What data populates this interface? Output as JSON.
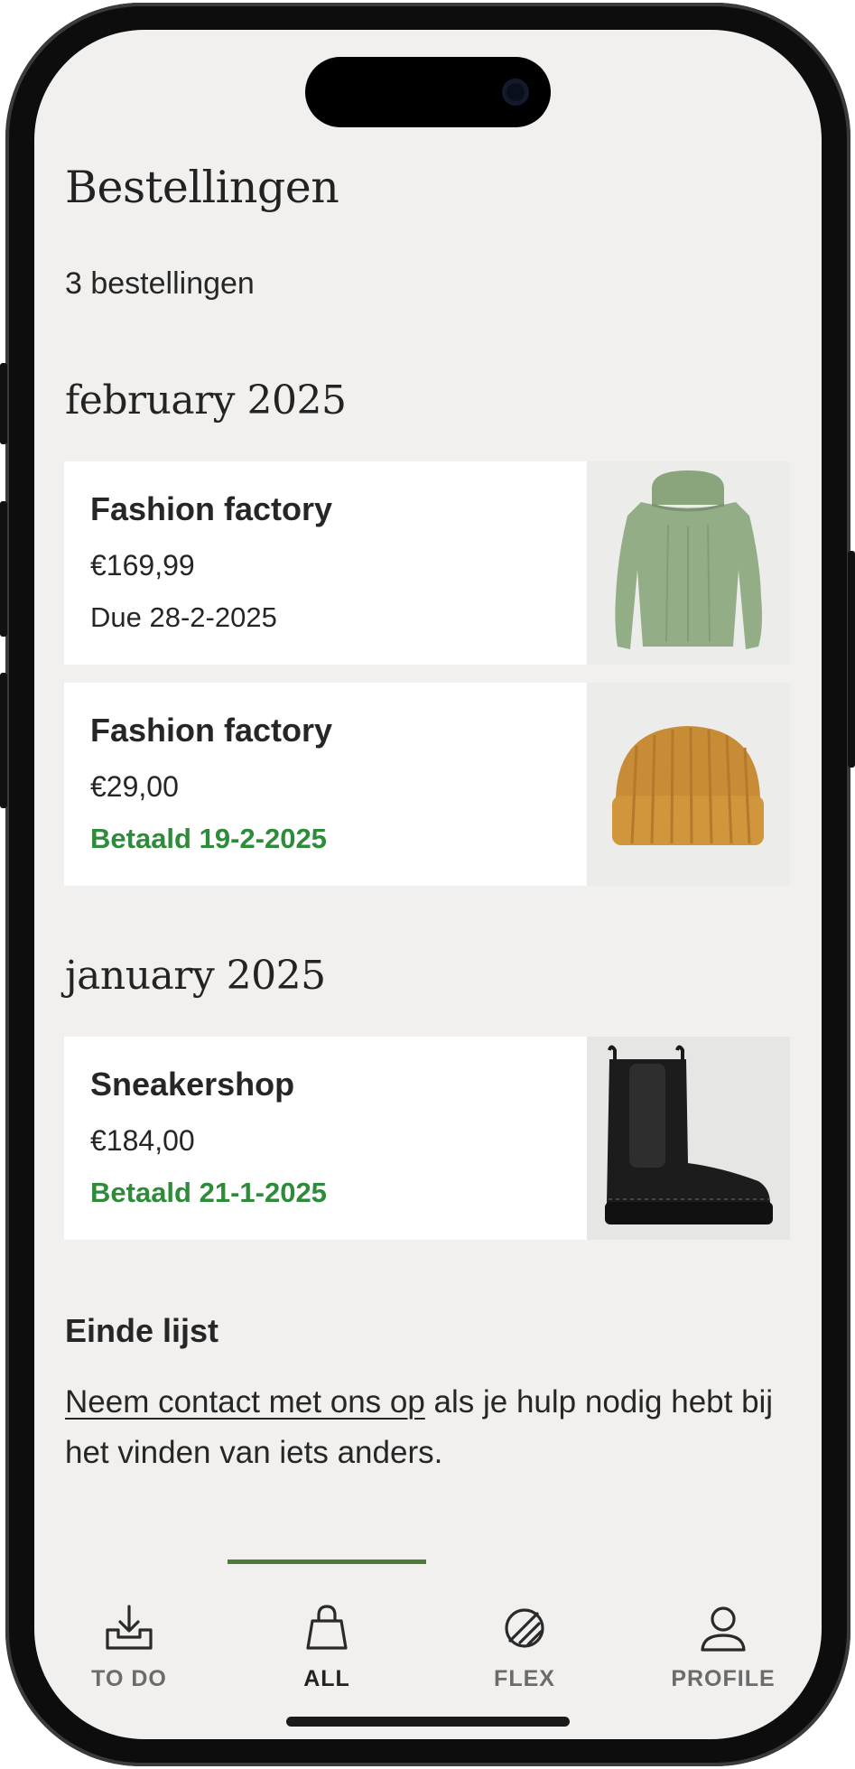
{
  "page": {
    "title": "Bestellingen",
    "count_text": "3 bestellingen"
  },
  "months": [
    {
      "label": "february 2025",
      "orders": [
        {
          "merchant": "Fashion factory",
          "amount": "€169,99",
          "status": "Due 28-2-2025",
          "status_type": "due",
          "image": "green-turtleneck-sweater"
        },
        {
          "merchant": "Fashion factory",
          "amount": "€29,00",
          "status": "Betaald 19-2-2025",
          "status_type": "paid",
          "image": "mustard-beanie"
        }
      ]
    },
    {
      "label": "january 2025",
      "orders": [
        {
          "merchant": "Sneakershop",
          "amount": "€184,00",
          "status": "Betaald 21-1-2025",
          "status_type": "paid",
          "image": "black-chelsea-boot"
        }
      ]
    }
  ],
  "end_of_list": {
    "title": "Einde lijst",
    "link_text": "Neem contact met ons op",
    "text": " als je hulp nodig hebt bij het vinden van iets anders."
  },
  "tabs": [
    {
      "label": "TO DO",
      "icon": "inbox-download-icon",
      "active": false
    },
    {
      "label": "ALL",
      "icon": "shopping-bag-icon",
      "active": true
    },
    {
      "label": "FLEX",
      "icon": "flex-circle-icon",
      "active": false
    },
    {
      "label": "PROFILE",
      "icon": "person-icon",
      "active": false
    }
  ],
  "colors": {
    "background": "#f1f0ee",
    "paid_green": "#2e8b3a",
    "tab_indicator": "#4e7a3a",
    "text": "#262626"
  }
}
